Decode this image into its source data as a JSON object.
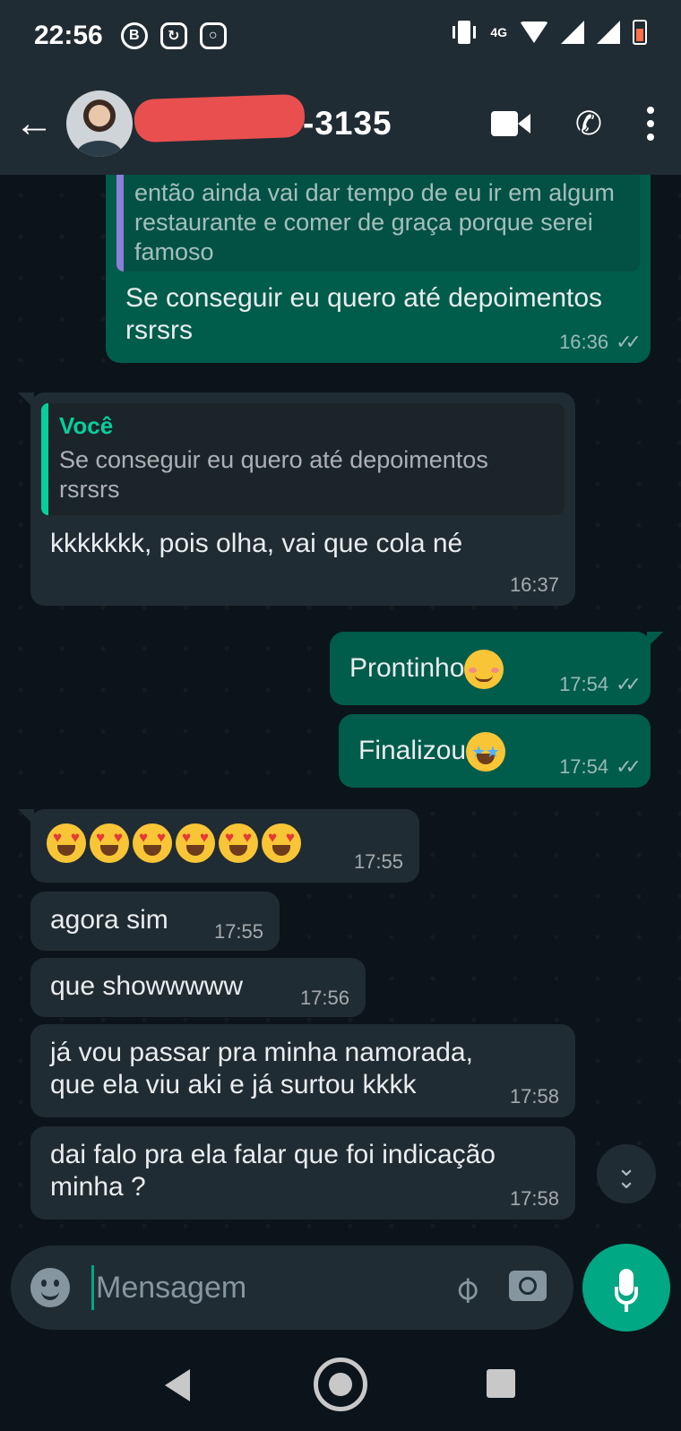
{
  "status_bar": {
    "time": "22:56",
    "network": "4G"
  },
  "header": {
    "contact_name_visible": "-3135"
  },
  "messages": [
    {
      "direction": "out",
      "quote_text": "então ainda vai dar tempo de eu ir em algum restaurante e comer de graça porque serei famoso",
      "text": "Se conseguir eu quero até depoimentos rsrsrs",
      "time": "16:36"
    },
    {
      "direction": "in",
      "quote_author": "Você",
      "quote_text": "Se conseguir eu quero até depoimentos rsrsrs",
      "text": "kkkkkkk, pois olha, vai que cola né",
      "time": "16:37"
    },
    {
      "direction": "out",
      "text": "Prontinho",
      "emoji": "smiling-face",
      "time": "17:54"
    },
    {
      "direction": "out",
      "text": "Finalizou",
      "emoji": "star-struck",
      "time": "17:54"
    },
    {
      "direction": "in",
      "emoji_count": 6,
      "emoji": "heart-eyes",
      "time": "17:55"
    },
    {
      "direction": "in",
      "text": "agora sim",
      "time": "17:55"
    },
    {
      "direction": "in",
      "text": "que showwwww",
      "time": "17:56"
    },
    {
      "direction": "in",
      "text": "já vou passar pra minha namorada, que ela viu aki e já surtou kkkk",
      "time": "17:58"
    },
    {
      "direction": "in",
      "text": "dai falo pra ela falar que foi indicação minha ?",
      "time": "17:58"
    }
  ],
  "composer": {
    "placeholder": "Mensagem"
  },
  "colors": {
    "outgoing_bubble": "#005c4b",
    "incoming_bubble": "#202c33",
    "accent": "#00a884",
    "background": "#0b141a"
  }
}
